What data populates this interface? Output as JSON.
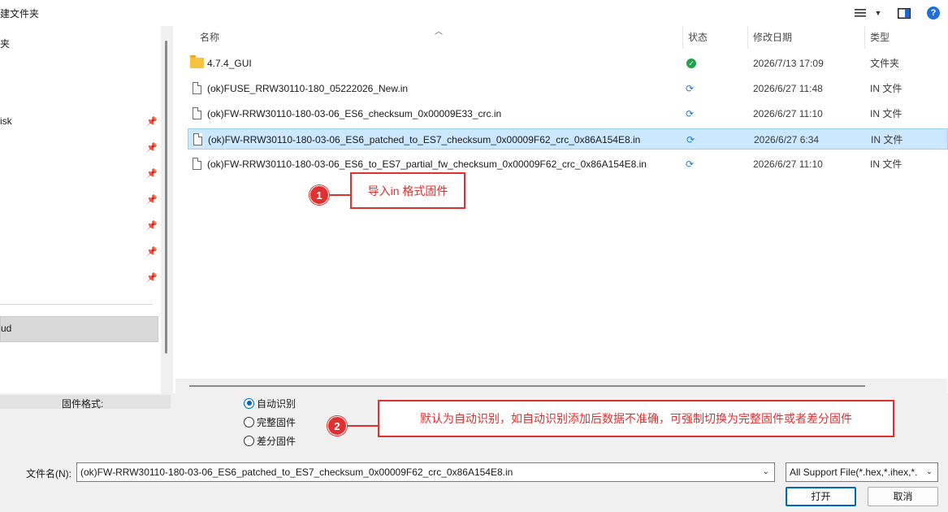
{
  "toolbar": {
    "new_folder_label": "建文件夹",
    "view_icon": "list-view-icon",
    "preview_icon": "preview-pane-icon",
    "help_icon": "help-icon",
    "help_glyph": "?"
  },
  "nav": {
    "items": [
      {
        "label": "夹"
      },
      {
        "label": "isk"
      },
      {
        "label": "ud"
      }
    ],
    "pin_glyph": "📌"
  },
  "list": {
    "columns": {
      "name": "名称",
      "status": "状态",
      "modified": "修改日期",
      "type": "类型"
    },
    "sort_glyph": "^",
    "rows": [
      {
        "name": "4.7.4_GUI",
        "icon": "folder-icon",
        "status": "synced",
        "modified": "2026/7/13 17:09",
        "type": "文件夹",
        "selected": false
      },
      {
        "name": "(ok)FUSE_RRW30110-180_05222026_New.in",
        "icon": "file-icon",
        "status": "sync-pending",
        "modified": "2026/6/27 11:48",
        "type": "IN 文件",
        "selected": false
      },
      {
        "name": "(ok)FW-RRW30110-180-03-06_ES6_checksum_0x00009E33_crc.in",
        "icon": "file-icon",
        "status": "sync-pending",
        "modified": "2026/6/27 11:10",
        "type": "IN 文件",
        "selected": false
      },
      {
        "name": "(ok)FW-RRW30110-180-03-06_ES6_patched_to_ES7_checksum_0x00009F62_crc_0x86A154E8.in",
        "icon": "file-icon",
        "status": "sync-pending",
        "modified": "2026/6/27 6:34",
        "type": "IN 文件",
        "selected": true
      },
      {
        "name": "(ok)FW-RRW30110-180-03-06_ES6_to_ES7_partial_fw_checksum_0x00009F62_crc_0x86A154E8.in",
        "icon": "file-icon",
        "status": "sync-pending",
        "modified": "2026/6/27 11:10",
        "type": "IN 文件",
        "selected": false
      }
    ],
    "sync_glyph": "⟳",
    "ok_glyph": "✓"
  },
  "annotations": {
    "one": {
      "number": "1",
      "text": "导入in 格式固件"
    },
    "two": {
      "number": "2",
      "text": "默认为自动识别，如自动识别添加后数据不准确，可强制切换为完整固件或者差分固件"
    }
  },
  "format": {
    "label": "固件格式:",
    "options": [
      {
        "label": "自动识别",
        "checked": true
      },
      {
        "label": "完整固件",
        "checked": false
      },
      {
        "label": "差分固件",
        "checked": false
      }
    ]
  },
  "footer": {
    "filename_label": "文件名(N):",
    "filename_value": "(ok)FW-RRW30110-180-03-06_ES6_patched_to_ES7_checksum_0x00009F62_crc_0x86A154E8.in",
    "filter_value": "All Support File(*.hex,*.ihex,*.",
    "dropdown_glyph": "⌄",
    "open_label": "打开",
    "cancel_label": "取消"
  },
  "colors": {
    "accent": "#0067c0",
    "annotation_red": "#e0302f",
    "selection": "#cce8ff"
  }
}
